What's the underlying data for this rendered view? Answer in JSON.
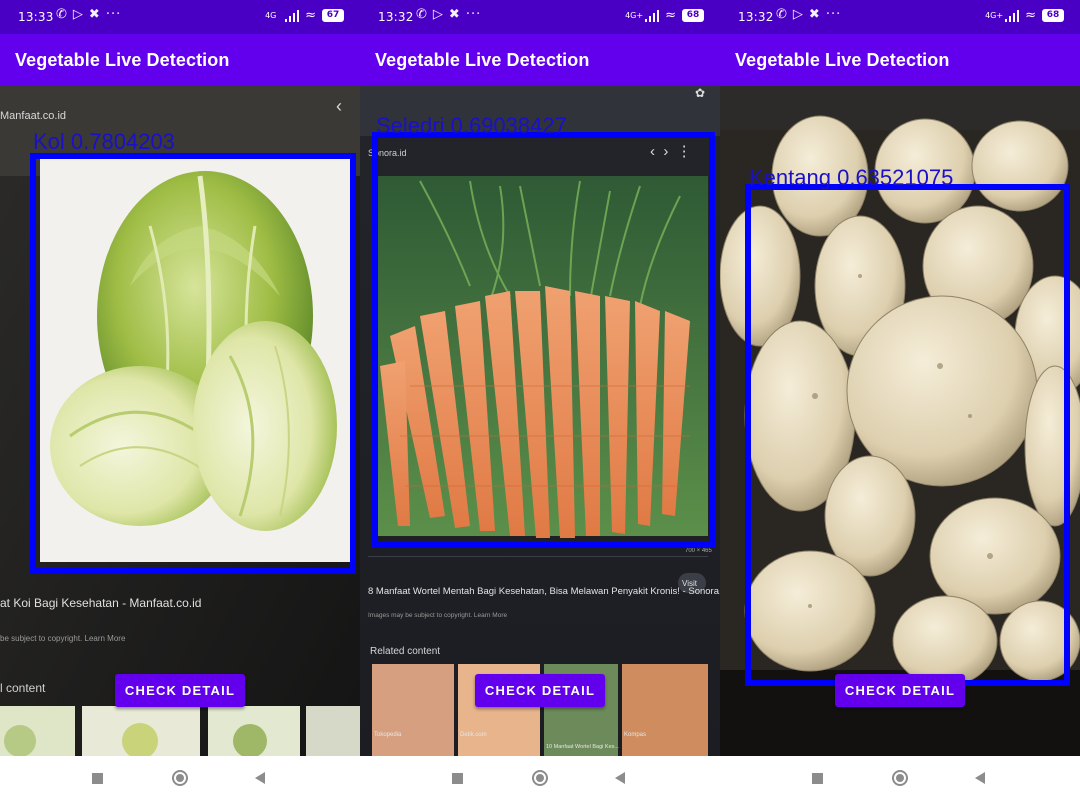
{
  "panels": [
    {
      "status": {
        "time": "13:33",
        "network": "4G",
        "battery": "67"
      },
      "app_title": "Vegetable Live Detection",
      "detection": {
        "label": "Kol",
        "confidence": "0.7804203"
      },
      "button_label": "CHECK DETAIL",
      "background_text": {
        "site": "Manfaat.co.id",
        "caption": "at Koi Bagi Kesehatan - Manfaat.co.id",
        "copyright": "be subject to copyright. Learn More",
        "related": "l content"
      }
    },
    {
      "status": {
        "time": "13:32",
        "network": "4G+",
        "battery": "68"
      },
      "app_title": "Vegetable Live Detection",
      "detection": {
        "label": "Seledri",
        "confidence": "0.69038427"
      },
      "button_label": "CHECK DETAIL",
      "background_text": {
        "site": "Sonora.id",
        "caption": "8 Manfaat Wortel Mentah Bagi Kesehatan, Bisa Melawan Penyakit Kronis! - Sonora.id",
        "copyright": "Images may be subject to copyright. Learn More",
        "related": "Related content",
        "visit": "Visit",
        "size": "700 × 465",
        "thumb1": "Tokopedia",
        "thumb2": "Detik.com",
        "thumb3": "Kompas",
        "thumb2_caption": "10 Manfaat Wortel Bagi Kes..."
      }
    },
    {
      "status": {
        "time": "13:32",
        "network": "4G+",
        "battery": "68"
      },
      "app_title": "Vegetable Live Detection",
      "detection": {
        "label": "Kentang",
        "confidence": "0.63521075"
      },
      "button_label": "CHECK DETAIL"
    }
  ],
  "icons": {
    "status": [
      "whatsapp-icon",
      "play-icon",
      "tool-icon",
      "more-dots-icon",
      "signal-icon",
      "wifi-icon",
      "battery-icon"
    ],
    "nav": [
      "recents-square-icon",
      "home-circle-icon",
      "back-triangle-icon"
    ]
  },
  "colors": {
    "status_bar": "#4a00c4",
    "app_bar": "#6200ee",
    "button": "#6200ee",
    "detection_box": "#0000ff",
    "detection_text": "#1a10c8"
  }
}
